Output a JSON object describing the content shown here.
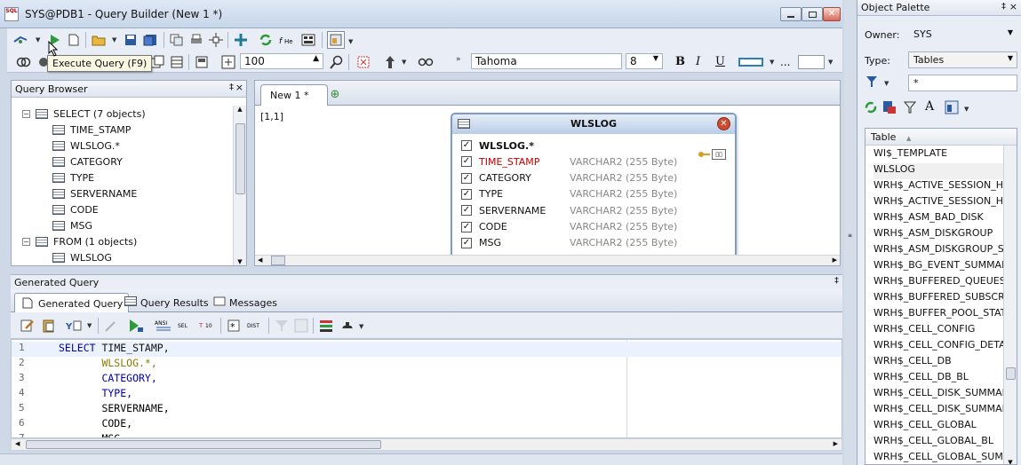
{
  "window": {
    "title": "SYS@PDB1 - Query Builder (New 1 *)",
    "app_icon_text": "SQL"
  },
  "tooltip": "Execute Query (F9)",
  "toolbar": {
    "zoom_value": "100",
    "font_name": "Tahoma",
    "font_size": "8",
    "bold_label": "B",
    "italic_label": "I",
    "underline_label": "U",
    "more_label": "..."
  },
  "query_browser": {
    "title": "Query Browser",
    "pin": "‡",
    "close": "×",
    "select_group": "SELECT   (7 objects)",
    "select_items": [
      "TIME_STAMP",
      "WLSLOG.*",
      "CATEGORY",
      "TYPE",
      "SERVERNAME",
      "CODE",
      "MSG"
    ],
    "from_group": "FROM   (1 objects)",
    "from_items": [
      "WLSLOG"
    ]
  },
  "canvas": {
    "tab_label": "New 1 *",
    "coord": "[1,1]",
    "table": {
      "title": "WLSLOG",
      "rows": [
        {
          "name": "WLSLOG.*",
          "type": "",
          "bold": true,
          "highlight": false
        },
        {
          "name": "TIME_STAMP",
          "type": "VARCHAR2 (255 Byte)",
          "bold": false,
          "highlight": true
        },
        {
          "name": "CATEGORY",
          "type": "VARCHAR2 (255 Byte)",
          "bold": false,
          "highlight": false
        },
        {
          "name": "TYPE",
          "type": "VARCHAR2 (255 Byte)",
          "bold": false,
          "highlight": false
        },
        {
          "name": "SERVERNAME",
          "type": "VARCHAR2 (255 Byte)",
          "bold": false,
          "highlight": false
        },
        {
          "name": "CODE",
          "type": "VARCHAR2 (255 Byte)",
          "bold": false,
          "highlight": false
        },
        {
          "name": "MSG",
          "type": "VARCHAR2 (255 Byte)",
          "bold": false,
          "highlight": false
        }
      ]
    }
  },
  "generated_query": {
    "title": "Generated Query",
    "tabs": [
      "Generated Query",
      "Query Results",
      "Messages"
    ],
    "toolbar_labels": {
      "ansi": "ANSI",
      "sel": "SEL",
      "dist": "DIST"
    },
    "lines": [
      {
        "num": "1",
        "code": "SELECT TIME_STAMP,",
        "kw": "SELECT",
        "rest": " TIME_STAMP,",
        "color": "#000000"
      },
      {
        "num": "2",
        "code": "       WLSLOG.*,",
        "kw": "",
        "rest": "       WLSLOG.*,",
        "color": "#8a7a00"
      },
      {
        "num": "3",
        "code": "       CATEGORY,",
        "kw": "",
        "rest": "       CATEGORY,",
        "color": "#0000b0"
      },
      {
        "num": "4",
        "code": "       TYPE,",
        "kw": "",
        "rest": "       TYPE,",
        "color": "#0000b0"
      },
      {
        "num": "5",
        "code": "       SERVERNAME,",
        "kw": "",
        "rest": "       SERVERNAME,",
        "color": "#000000"
      },
      {
        "num": "6",
        "code": "       CODE,",
        "kw": "",
        "rest": "       CODE,",
        "color": "#000000"
      },
      {
        "num": "7",
        "code": "       MSG",
        "kw": "",
        "rest": "       MSG",
        "color": "#000000"
      }
    ]
  },
  "palette": {
    "title": "Object Palette",
    "owner_label": "Owner:",
    "owner_value": "SYS",
    "type_label": "Type:",
    "type_value": "Tables",
    "filter_value": "*",
    "list_header": "Table",
    "tables": [
      "WI$_TEMPLATE",
      "WLSLOG",
      "WRH$_ACTIVE_SESSION_HIS",
      "WRH$_ACTIVE_SESSION_HIS",
      "WRH$_ASM_BAD_DISK",
      "WRH$_ASM_DISKGROUP",
      "WRH$_ASM_DISKGROUP_STA",
      "WRH$_BG_EVENT_SUMMARY",
      "WRH$_BUFFERED_QUEUES",
      "WRH$_BUFFERED_SUBSCRIBE",
      "WRH$_BUFFER_POOL_STATIS",
      "WRH$_CELL_CONFIG",
      "WRH$_CELL_CONFIG_DETAIL",
      "WRH$_CELL_DB",
      "WRH$_CELL_DB_BL",
      "WRH$_CELL_DISK_SUMMARY",
      "WRH$_CELL_DISK_SUMMARY_",
      "WRH$_CELL_GLOBAL",
      "WRH$_CELL_GLOBAL_BL",
      "WRH$_CELL_GLOBAL_SUMMA"
    ]
  },
  "colors": {
    "accent": "#2c5aa0",
    "highlight_column": "#c00000",
    "type_text": "#888888",
    "keyword": "#0000b0"
  }
}
